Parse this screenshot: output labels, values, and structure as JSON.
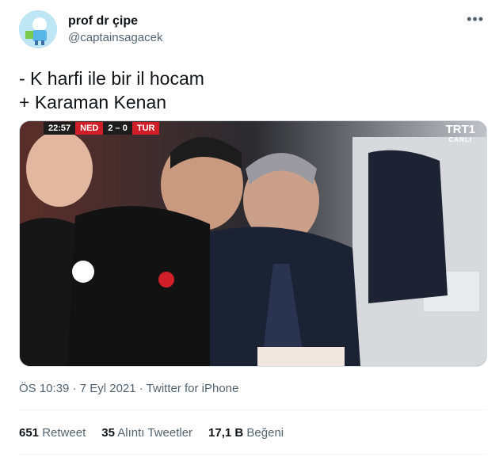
{
  "user": {
    "name": "prof dr çipe",
    "handle": "@captainsagacek"
  },
  "tweet": {
    "line1": "- K harfi ile bir il hocam",
    "line2": "+ Karaman Kenan"
  },
  "media": {
    "time": "22:57",
    "team1": "NED",
    "score": "2 – 0",
    "team2": "TUR",
    "channel": "TRT1",
    "live": "CANLI"
  },
  "meta": {
    "text": "ÖS 10:39 · 7 Eyl 2021 · Twitter for iPhone"
  },
  "stats": {
    "retweets": "651",
    "retweets_label": "Retweet",
    "quotes": "35",
    "quotes_label": "Alıntı Tweetler",
    "likes": "17,1 B",
    "likes_label": "Beğeni"
  },
  "icons": {
    "more": "more-dots-icon"
  }
}
